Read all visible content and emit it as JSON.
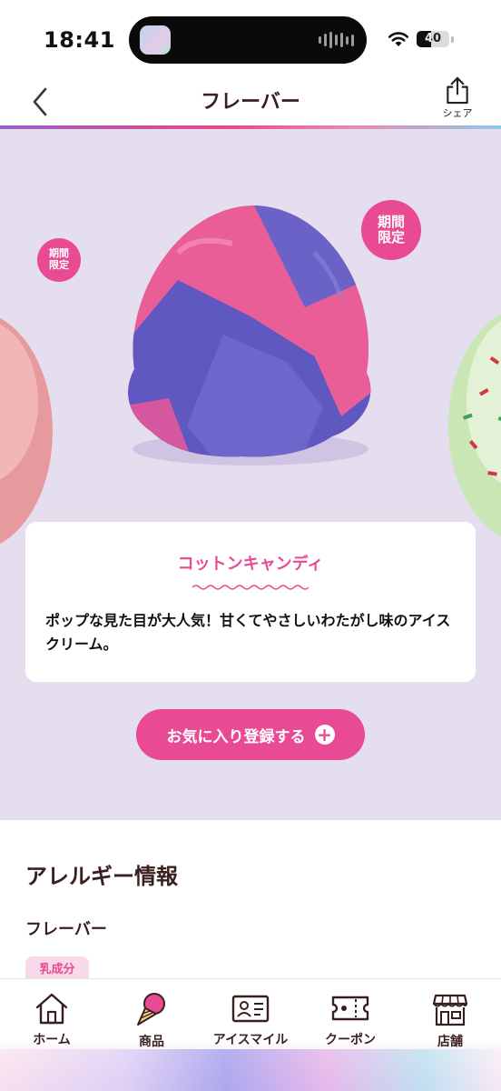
{
  "status_bar": {
    "time": "18:41",
    "battery": "40"
  },
  "header": {
    "title": "フレーバー",
    "share_label": "シェア"
  },
  "hero": {
    "badge_small": [
      "期間",
      "限定"
    ],
    "badge_large": [
      "期間",
      "限定"
    ]
  },
  "flavor": {
    "name": "コットンキャンディ",
    "description": "ポップな見た目が大人気！甘くてやさしいわたがし味のアイスクリーム。",
    "favorite_label": "お気に入り登録する"
  },
  "allergy": {
    "title": "アレルギー情報",
    "subtitle": "フレーバー",
    "tags": [
      "乳成分"
    ]
  },
  "nav": {
    "items": [
      {
        "label": "ホーム",
        "icon": "home-icon"
      },
      {
        "label": "商品",
        "icon": "ice-cream-icon"
      },
      {
        "label": "アイスマイル",
        "icon": "member-card-icon"
      },
      {
        "label": "クーポン",
        "icon": "coupon-icon"
      },
      {
        "label": "店舗",
        "icon": "store-icon"
      }
    ]
  },
  "colors": {
    "accent": "#e84a94",
    "hero_bg": "#e4deef",
    "text_dark": "#3a1f1f"
  }
}
